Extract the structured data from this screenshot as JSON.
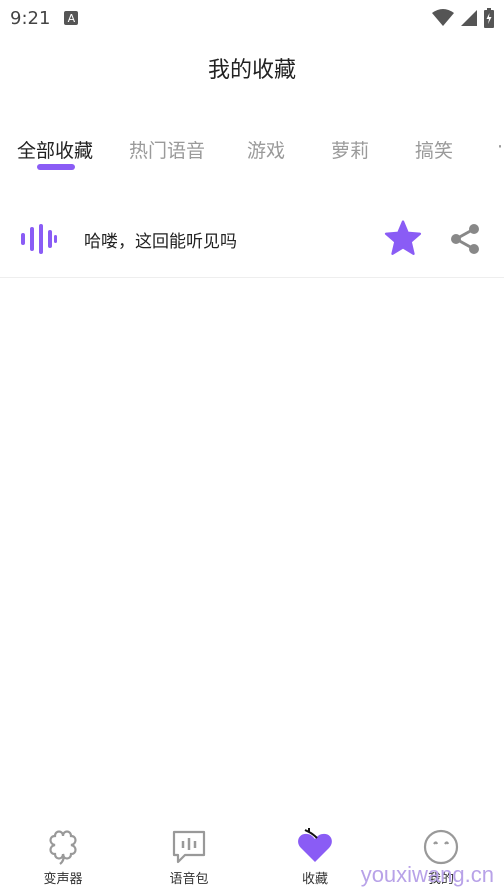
{
  "status_bar": {
    "time": "9:21",
    "notification_letter": "A"
  },
  "header": {
    "title": "我的收藏"
  },
  "tabs": [
    {
      "label": "全部收藏"
    },
    {
      "label": "热门语音"
    },
    {
      "label": "游戏"
    },
    {
      "label": "萝莉"
    },
    {
      "label": "搞笑"
    }
  ],
  "favorites": [
    {
      "text": "哈喽，这回能听见吗",
      "starred": true
    }
  ],
  "bottom_nav": [
    {
      "label": "变声器",
      "icon": "clover-icon"
    },
    {
      "label": "语音包",
      "icon": "chat-bars-icon"
    },
    {
      "label": "收藏",
      "icon": "heart-icon"
    },
    {
      "label": "我的",
      "icon": "face-icon"
    }
  ],
  "watermark": "youxiwang.cn",
  "colors": {
    "accent": "#8a5cf5",
    "text": "#222222",
    "muted": "#9a9a9a"
  }
}
